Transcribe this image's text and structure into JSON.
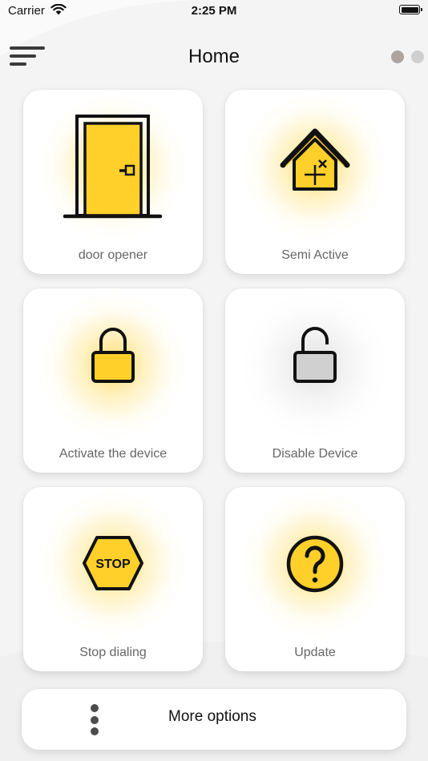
{
  "status_bar": {
    "carrier": "Carrier",
    "time": "2:25 PM"
  },
  "header": {
    "title": "Home",
    "page_indicator": {
      "count": 2,
      "active_index": 0
    }
  },
  "tiles": [
    {
      "label": "door opener",
      "icon": "door-icon",
      "glow": "yellow"
    },
    {
      "label": "Semi Active",
      "icon": "house-icon",
      "glow": "yellow"
    },
    {
      "label": "Activate the device",
      "icon": "lock-closed-icon",
      "glow": "yellow"
    },
    {
      "label": "Disable Device",
      "icon": "lock-open-icon",
      "glow": "grey"
    },
    {
      "label": "Stop dialing",
      "icon": "stop-sign-icon",
      "glow": "yellow",
      "icon_text": "STOP"
    },
    {
      "label": "Update",
      "icon": "question-circle-icon",
      "glow": "yellow"
    }
  ],
  "more_options": {
    "label": "More options",
    "icon": "kebab-menu-icon"
  },
  "colors": {
    "accent_yellow": "#FFD02A",
    "icon_grey": "#D0D0D0",
    "outline": "#111111",
    "background": "#F4F4F4",
    "tile": "#FFFFFF",
    "label": "#666666"
  }
}
